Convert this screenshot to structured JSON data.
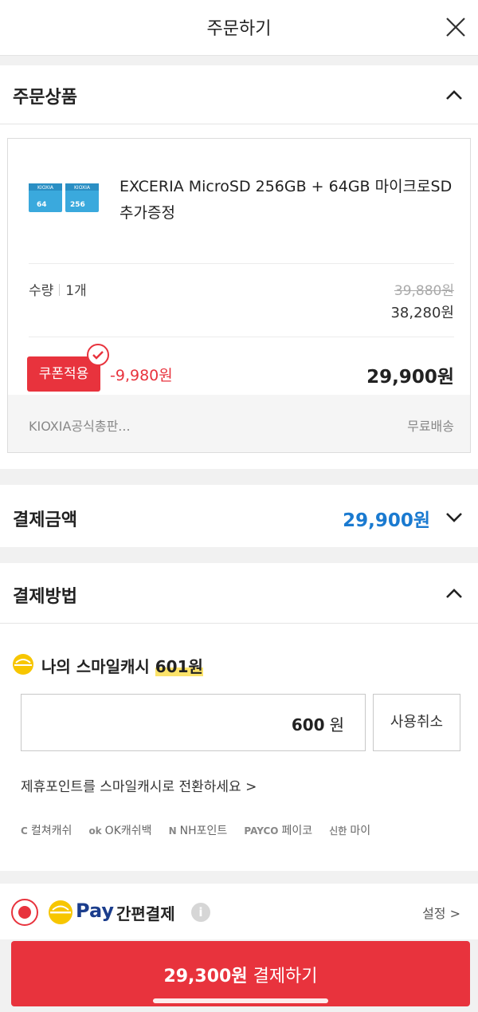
{
  "header": {
    "title": "주문하기"
  },
  "order_items": {
    "title": "주문상품",
    "product": {
      "name": "EXCERIA MicroSD 256GB + 64GB 마이크로SD 추가증정",
      "thumb_text_1": "KIOXIA",
      "thumb_text_2": "64",
      "thumb_text_3": "256",
      "qty_label": "수량",
      "qty_value": "1개",
      "original_price": "39,880원",
      "sale_price": "38,280원",
      "coupon_badge": "쿠폰적용",
      "coupon_discount": "-9,980원",
      "final_price": "29,900원",
      "seller": "KIOXIA공식총판...",
      "shipping": "무료배송"
    }
  },
  "payment_amount": {
    "title": "결제금액",
    "value": "29,900원"
  },
  "payment_method": {
    "title": "결제방법",
    "smile_cash": {
      "label": "나의 스마일캐시",
      "balance": "601원",
      "input_value": "600",
      "input_unit": "원",
      "cancel_label": "사용취소"
    },
    "convert_link": "제휴포인트를 스마일캐시로 전환하세요 >",
    "points": [
      {
        "icon": "C",
        "label": "컬쳐캐쉬"
      },
      {
        "icon": "ok",
        "label": "OK캐쉬백"
      },
      {
        "icon": "N",
        "label": "NH포인트"
      },
      {
        "icon": "PAYCO",
        "label": "페이코"
      },
      {
        "icon": "신한",
        "label": "마이"
      }
    ],
    "ezpay": {
      "pay_word": "Pay",
      "label": "간편결제",
      "info": "i",
      "settings": "설정 >"
    }
  },
  "pay_button": {
    "amount": "29,300원",
    "label": "결제하기"
  },
  "colors": {
    "accent_red": "#e8333d",
    "accent_blue": "#1a7ad0",
    "smile_yellow": "#f7c600"
  }
}
